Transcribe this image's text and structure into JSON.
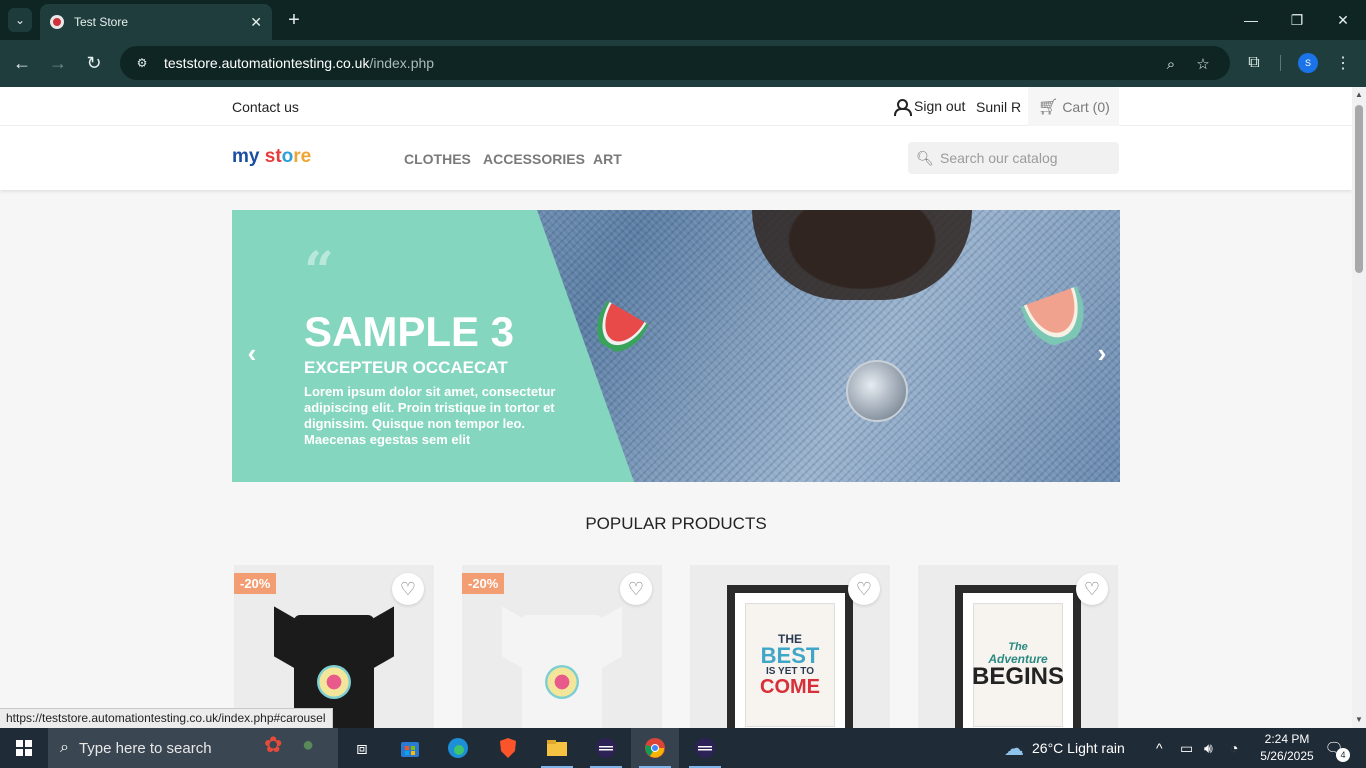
{
  "browser": {
    "tab_title": "Test Store",
    "url_host": "teststore.automationtesting.co.uk",
    "url_path": "/index.php",
    "profile_initial": "S"
  },
  "header": {
    "contact_label": "Contact us",
    "signout_label": "Sign out",
    "user_name": "Sunil R",
    "cart_label": "Cart (0)"
  },
  "nav": {
    "logo_parts": [
      "my",
      " st",
      "o",
      "re"
    ],
    "menu": [
      "CLOTHES",
      "ACCESSORIES",
      "ART"
    ],
    "search_placeholder": "Search our catalog"
  },
  "carousel": {
    "title": "SAMPLE 3",
    "subtitle": "EXCEPTEUR OCCAECAT",
    "text": "Lorem ipsum dolor sit amet, consectetur adipiscing elit. Proin tristique in tortor et dignissim. Quisque non tempor leo. Maecenas egestas sem elit",
    "quote_mark": "“",
    "prev_icon": "‹",
    "next_icon": "›"
  },
  "products": {
    "section_title": "POPULAR PRODUCTS",
    "items": [
      {
        "discount": "-20%",
        "image": "black-tshirt-hummingbird",
        "color": "#1b1b1b"
      },
      {
        "discount": "-20%",
        "image": "white-sweater-hummingbird",
        "color": "#f4f4f4"
      },
      {
        "discount": "",
        "image": "poster-the-best-is-yet-to-come",
        "lines": [
          "THE",
          "BEST",
          "IS YET TO",
          "COME"
        ]
      },
      {
        "discount": "",
        "image": "poster-the-adventure-begins",
        "lines": [
          "The",
          "Adventure",
          "BEGINS"
        ]
      }
    ]
  },
  "status_url": "https://teststore.automationtesting.co.uk/index.php#carousel",
  "taskbar": {
    "search_placeholder": "Type here to search",
    "weather": "26°C  Light rain",
    "time": "2:24 PM",
    "date": "5/26/2025",
    "notification_count": "4"
  },
  "colors": {
    "mint": "#84d6be",
    "discount": "#f39d72",
    "chrome_dark": "#0e2524"
  }
}
